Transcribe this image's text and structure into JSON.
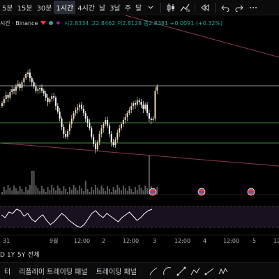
{
  "toolbar": {
    "timeframes": [
      {
        "label": "5분",
        "active": false
      },
      {
        "label": "15분",
        "active": false
      },
      {
        "label": "30분",
        "active": false
      },
      {
        "label": "1시간",
        "active": true
      },
      {
        "label": "4시간",
        "active": false
      },
      {
        "label": "날",
        "active": false
      },
      {
        "label": "3날",
        "active": false
      },
      {
        "label": "주",
        "active": false
      },
      {
        "label": "달",
        "active": false
      }
    ],
    "icons": [
      "chevron-down-icon",
      "candles-icon",
      "indicators-icon",
      "undo-icon",
      "redo-icon",
      "rewind-icon",
      "more-icon"
    ]
  },
  "legend": {
    "symbol": "시간 · Binance",
    "ohlc": "시2.8334 고2.8462 저2.8128 종2.8381 +0.0091 (+0.32%)"
  },
  "time_axis": {
    "labels": [
      "31",
      "9월",
      "12:00",
      "2",
      "12:00",
      "3",
      "12:00",
      "4",
      "12:00",
      "5",
      "12"
    ]
  },
  "bottom_tabs": {
    "items": [
      "터",
      "리플레이 트레이딩 패널",
      "트레이딩 패널"
    ]
  },
  "colors": {
    "up": "#e6d5b8",
    "down": "#ffffff",
    "green_line": "#3c8f3c",
    "red_line": "#8a3a4a",
    "rsi": "#ffffff",
    "volume": "#5a5a5a"
  }
}
